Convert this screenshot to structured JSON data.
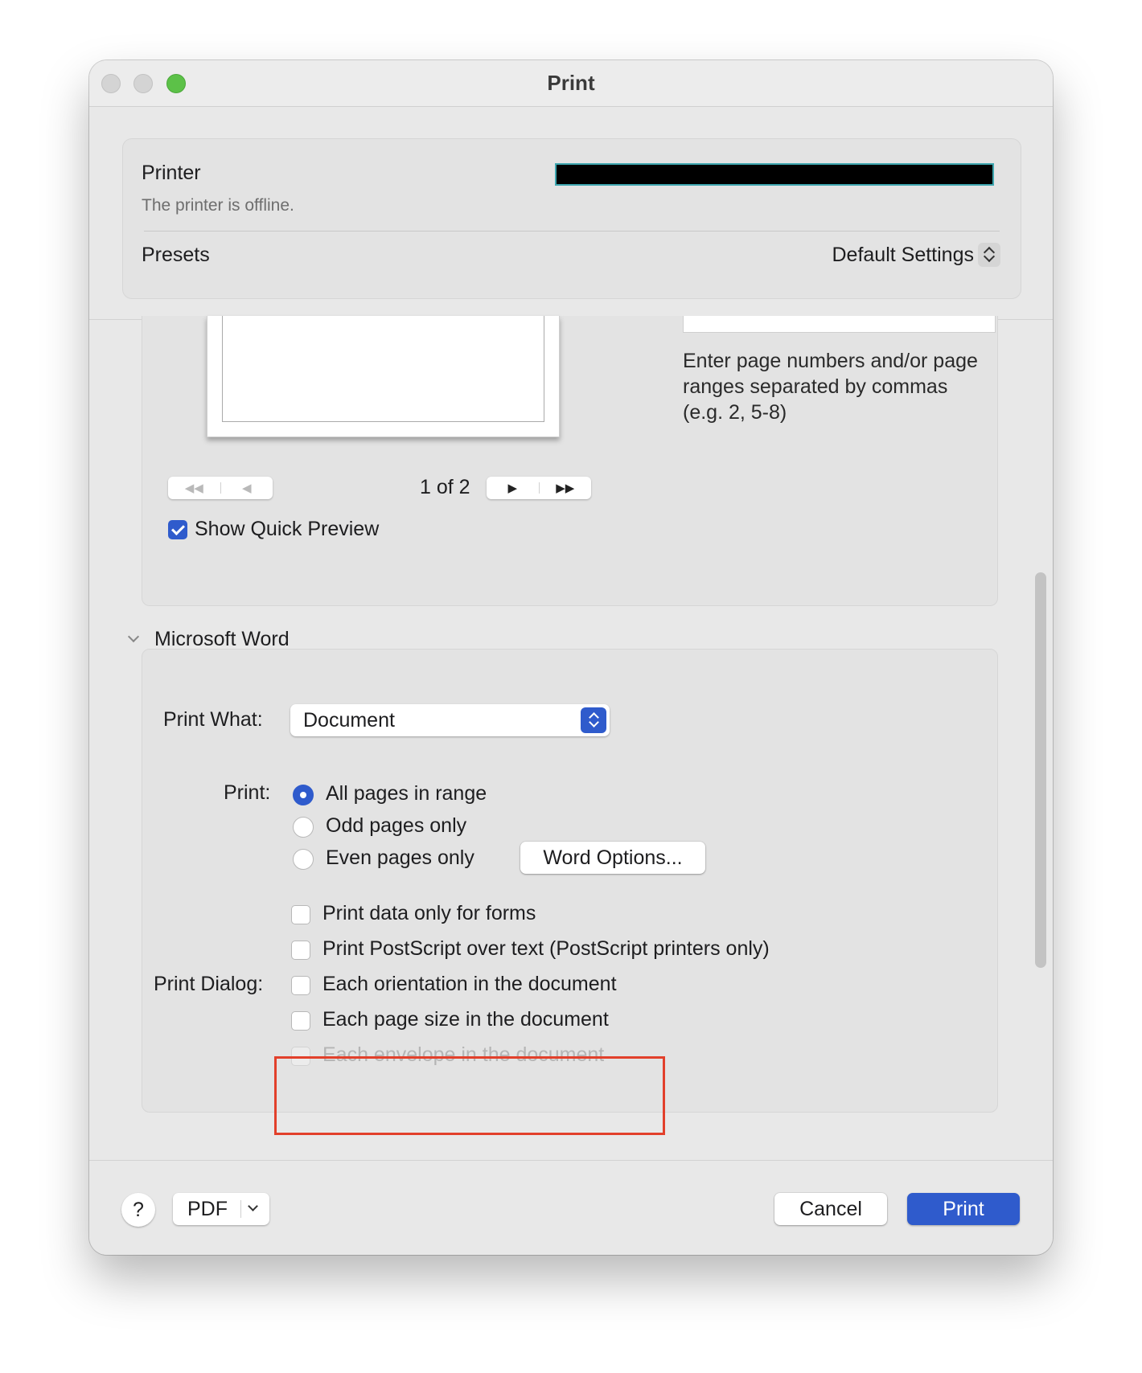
{
  "window": {
    "title": "Print"
  },
  "printer": {
    "label": "Printer",
    "status": "The printer is offline.",
    "presets_label": "Presets",
    "presets_value": "Default Settings"
  },
  "preview": {
    "range_hint": "Enter page numbers and/or page ranges separated by commas (e.g. 2, 5-8)",
    "page_indicator": "1 of 2",
    "nav_first": "◀◀",
    "nav_prev": "◀",
    "nav_next": "▶",
    "nav_last": "▶▶",
    "show_quick_preview_label": "Show Quick Preview",
    "show_quick_preview_checked": true
  },
  "word_section": {
    "title": "Microsoft Word",
    "print_what_label": "Print What:",
    "print_what_value": "Document",
    "print_label": "Print:",
    "print_options": [
      {
        "label": "All pages in range",
        "selected": true
      },
      {
        "label": "Odd pages only",
        "selected": false
      },
      {
        "label": "Even pages only",
        "selected": false
      }
    ],
    "word_options_button": "Word Options...",
    "checkboxes": [
      {
        "label": "Print data only for forms",
        "checked": false,
        "enabled": true
      },
      {
        "label": "Print PostScript over text (PostScript printers only)",
        "checked": false,
        "enabled": true
      },
      {
        "label": "Each orientation in the document",
        "checked": false,
        "enabled": true
      },
      {
        "label": "Each page size in the document",
        "checked": false,
        "enabled": true
      },
      {
        "label": "Each envelope in the document",
        "checked": false,
        "enabled": false
      }
    ],
    "print_dialog_label": "Print Dialog:"
  },
  "footer": {
    "help_label": "?",
    "pdf_label": "PDF",
    "cancel_label": "Cancel",
    "print_label": "Print"
  },
  "colors": {
    "accent": "#2f5bcc",
    "highlight_box": "#e2402b",
    "traffic_green": "#5cc148"
  }
}
